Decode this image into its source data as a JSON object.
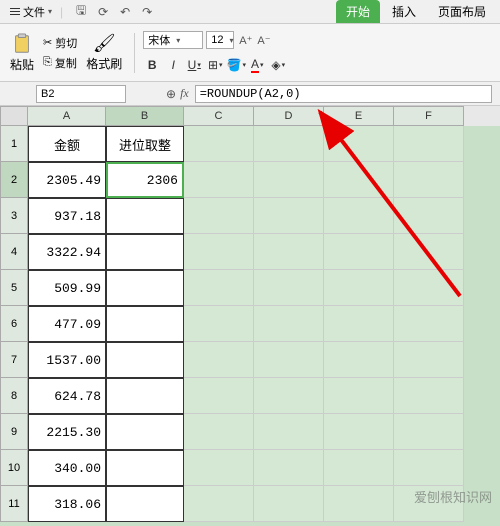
{
  "menu": {
    "file_label": "文件",
    "tabs": {
      "start": "开始",
      "insert": "插入",
      "layout": "页面布局"
    }
  },
  "ribbon": {
    "paste": "粘贴",
    "cut": "剪切",
    "copy": "复制",
    "format_painter": "格式刷",
    "font_name": "宋体",
    "font_size": "12",
    "bold": "B",
    "italic": "I",
    "underline": "U",
    "strike": "A"
  },
  "namebox": "B2",
  "formula": "=ROUNDUP(A2,0)",
  "columns": [
    "A",
    "B",
    "C",
    "D",
    "E",
    "F"
  ],
  "headers": {
    "amount": "金额",
    "round": "进位取整"
  },
  "rows": [
    {
      "n": 1,
      "a": "金额",
      "b": "进位取整",
      "header": true
    },
    {
      "n": 2,
      "a": "2305.49",
      "b": "2306",
      "sel": true
    },
    {
      "n": 3,
      "a": "937.18",
      "b": ""
    },
    {
      "n": 4,
      "a": "3322.94",
      "b": ""
    },
    {
      "n": 5,
      "a": "509.99",
      "b": ""
    },
    {
      "n": 6,
      "a": "477.09",
      "b": ""
    },
    {
      "n": 7,
      "a": "1537.00",
      "b": ""
    },
    {
      "n": 8,
      "a": "624.78",
      "b": ""
    },
    {
      "n": 9,
      "a": "2215.30",
      "b": ""
    },
    {
      "n": 10,
      "a": "340.00",
      "b": ""
    },
    {
      "n": 11,
      "a": "318.06",
      "b": ""
    }
  ],
  "watermark": "爱刨根知识网"
}
